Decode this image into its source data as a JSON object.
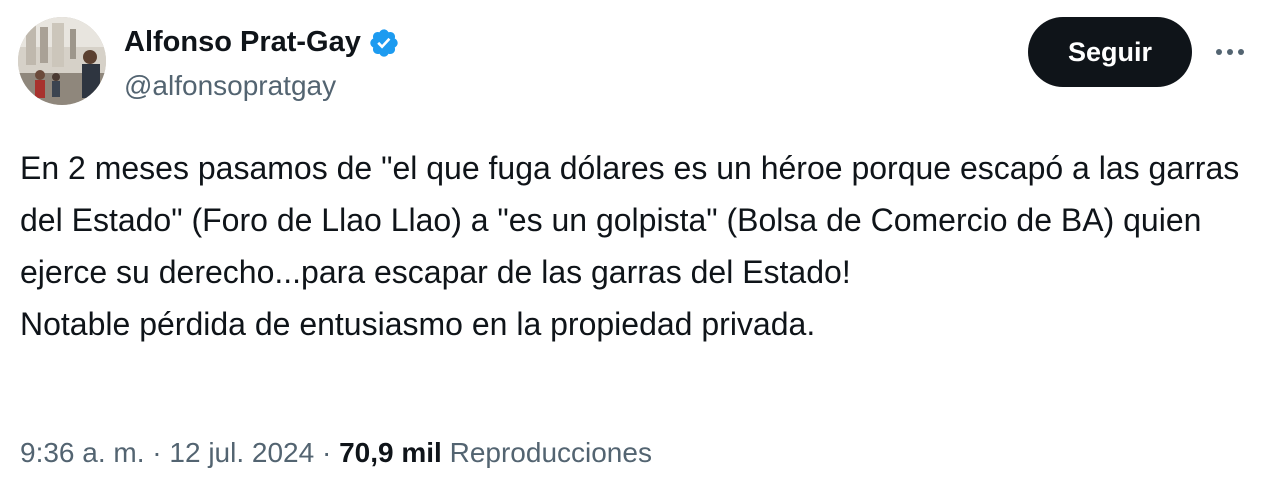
{
  "author": {
    "name": "Alfonso Prat-Gay",
    "handle": "@alfonsopratgay",
    "verified": true,
    "verified_color": "#1d9bf0"
  },
  "actions": {
    "follow_label": "Seguir",
    "more_icon": "more-horizontal-icon"
  },
  "tweet": {
    "paragraph_1": "En 2 meses pasamos de \"el que fuga dólares es un héroe porque escapó a las garras del Estado\" (Foro de Llao Llao) a \"es un golpista\" (Bolsa de Comercio de BA) quien ejerce su derecho...para escapar de las garras del Estado!",
    "paragraph_2": "Notable pérdida de entusiasmo en la propiedad privada."
  },
  "meta": {
    "time": "9:36 a. m.",
    "separator": "·",
    "date": "12 jul. 2024",
    "views_count": "70,9 mil",
    "views_label": "Reproducciones"
  },
  "colors": {
    "text": "#0f1419",
    "secondary": "#536471",
    "button_bg": "#0f1419",
    "accent": "#1d9bf0"
  }
}
